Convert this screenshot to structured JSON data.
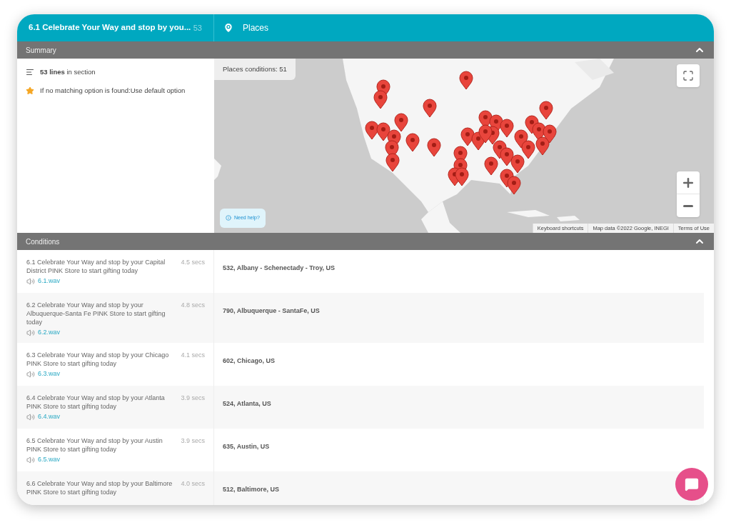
{
  "header": {
    "title": "6.1 Celebrate Your Way and stop by you...",
    "count": "53",
    "places_label": "Places"
  },
  "summary": {
    "title": "Summary",
    "expanded": true,
    "lines": "**53 lines** in section",
    "default_note": "If no matching option is found:Use default option"
  },
  "map": {
    "conditions_label": "Places conditions: 51",
    "help": "Need help?",
    "attribution": [
      "Keyboard shortcuts",
      "Map data ©2022 Google, INEGI",
      "Terms of Use"
    ]
  },
  "conditions": {
    "title": "Conditions",
    "expanded": true,
    "rows": [
      {
        "text": "6.1 Celebrate Your Way and stop by your Capital District PINK Store to start gifting today",
        "duration": "4.5 secs",
        "file": "6.1.wav",
        "place": "532, Albany - Schenectady - Troy, US"
      },
      {
        "text": "6.2 Celebrate Your Way and stop by your Albuquerque-Santa Fe PINK Store to start gifting today",
        "duration": "4.8 secs",
        "file": "6.2.wav",
        "place": "790, Albuquerque - SantaFe, US"
      },
      {
        "text": "6.3 Celebrate Your Way and stop by your Chicago PINK Store to start gifting today",
        "duration": "4.1 secs",
        "file": "6.3.wav",
        "place": "602, Chicago, US"
      },
      {
        "text": "6.4 Celebrate Your Way and stop by your Atlanta PINK Store to start gifting today",
        "duration": "3.9 secs",
        "file": "6.4.wav",
        "place": "524, Atlanta, US"
      },
      {
        "text": "6.5 Celebrate Your Way and stop by your Austin PINK Store to start gifting today",
        "duration": "3.9 secs",
        "file": "6.5.wav",
        "place": "635, Austin, US"
      },
      {
        "text": "6.6 Celebrate Your Way and stop by your Baltimore PINK Store to start gifting today",
        "duration": "4.0 secs",
        "place": "512, Baltimore, US"
      }
    ]
  }
}
